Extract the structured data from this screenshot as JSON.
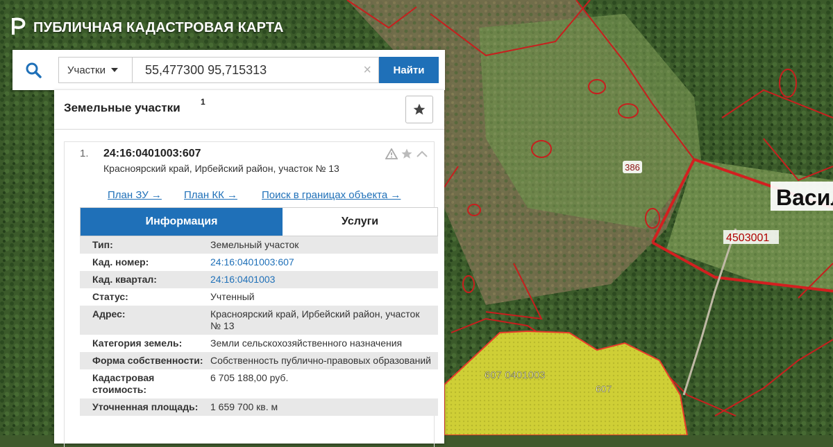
{
  "app": {
    "title": "ПУБЛИЧНАЯ КАДАСТРОВАЯ КАРТА"
  },
  "search": {
    "type_label": "Участки",
    "value": "55,477300 95,715313",
    "clear_symbol": "×",
    "button_label": "Найти"
  },
  "panel": {
    "title": "Земельные участки",
    "count": "1"
  },
  "result": {
    "number": "1.",
    "cadastral_id": "24:16:0401003:607",
    "address": "Красноярский край, Ирбейский район, участок № 13",
    "links": {
      "plan_zu": "План ЗУ →",
      "plan_kk": "План КК →",
      "search_bounds": "Поиск в границах объекта →"
    },
    "tabs": {
      "info": "Информация",
      "services": "Услуги"
    },
    "info_rows": [
      {
        "label": "Тип:",
        "value": "Земельный участок"
      },
      {
        "label": "Кад. номер:",
        "value": "24:16:0401003:607"
      },
      {
        "label": "Кад. квартал:",
        "value": "24:16:0401003"
      },
      {
        "label": "Статус:",
        "value": "Учтенный"
      },
      {
        "label": "Адрес:",
        "value": "Красноярский край, Ирбейский район, участок № 13"
      },
      {
        "label": "Категория земель:",
        "value": "Земли сельскохозяйственного назначения"
      },
      {
        "label": "Форма собственности:",
        "value": "Собственность публично-правовых образований"
      },
      {
        "label": "Кадастровая стоимость:",
        "value": "6 705 188,00 руб."
      },
      {
        "label": "Уточненная площадь:",
        "value": "1 659 700 кв. м"
      }
    ]
  },
  "map": {
    "labels": {
      "parcel_386": "386",
      "village": "Васил",
      "quarter_right": "4503001",
      "quarter_bottom": "607 0401003",
      "parcel_607": "607"
    }
  },
  "colors": {
    "accent": "#1f70b8",
    "boundary": "#d22020",
    "parcel_fill": "#d9d83a"
  },
  "icons": [
    "logo-icon",
    "search-icon",
    "chevron-down-icon",
    "clear-icon",
    "star-icon",
    "warning-icon",
    "chevron-up-icon"
  ]
}
